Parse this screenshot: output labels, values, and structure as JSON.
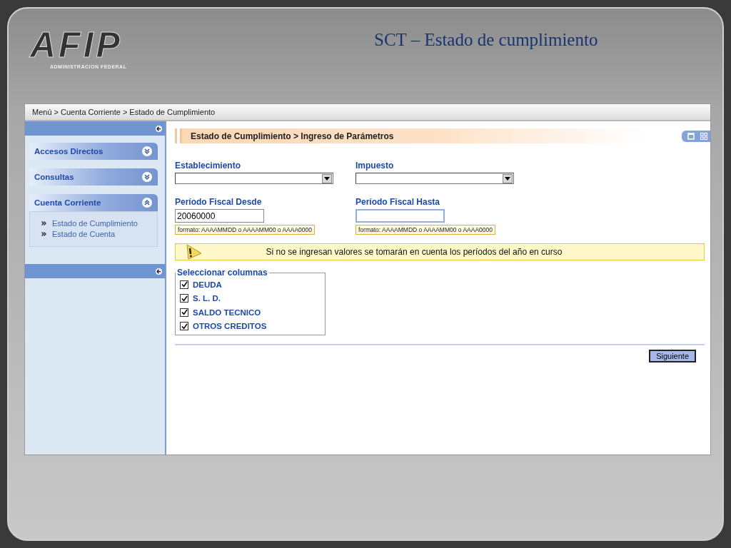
{
  "slide": {
    "logo": {
      "name": "AFIP",
      "subtitle": "ADMINISTRACION FEDERAL"
    },
    "title": "SCT – Estado de cumplimiento"
  },
  "breadcrumb": "Menú > Cuenta Corriente > Estado de Cumplimiento",
  "sidebar": {
    "sections": [
      {
        "label": "Accesos Directos",
        "expanded": false
      },
      {
        "label": "Consultas",
        "expanded": false
      },
      {
        "label": "Cuenta Corriente",
        "expanded": true,
        "items": [
          {
            "label": "Estado de Cumplimiento"
          },
          {
            "label": "Estado de Cuenta"
          }
        ]
      }
    ]
  },
  "header": "Estado de Cumplimiento > Ingreso de Parámetros",
  "fields": [
    {
      "kind": "select",
      "label": "Establecimiento"
    },
    {
      "kind": "select",
      "label": "Impuesto"
    },
    {
      "kind": "text",
      "label": "Período Fiscal Desde",
      "value": "20060000",
      "focused": false,
      "hint": "formato: AAAAMMDD o AAAAMM00 o AAAA0000"
    },
    {
      "kind": "text",
      "label": "Período Fiscal Hasta",
      "focused": true,
      "hint": "formato: AAAAMMDD o AAAAMM00 o AAAA0000"
    }
  ],
  "warning": "Si no se ingresan valores se tomarán en cuenta los períodos del año en curso",
  "columns": {
    "legend": "Seleccionar columnas",
    "options": [
      {
        "label": "DEUDA",
        "checked": true
      },
      {
        "label": "S. L. D.",
        "checked": true
      },
      {
        "label": "SALDO TECNICO",
        "checked": true
      },
      {
        "label": "OTROS CREDITOS",
        "checked": true
      }
    ]
  },
  "next_button": "Siguiente"
}
